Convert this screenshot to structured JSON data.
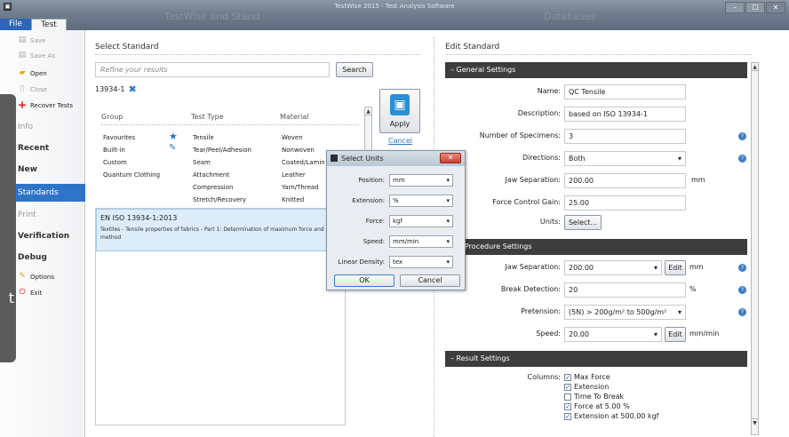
{
  "window": {
    "title": "TestWise 2015 - Test Analysis Software",
    "ghost_left": "TestWise and Stand",
    "ghost_right": "Databases",
    "minimize": "–",
    "maximize": "☐",
    "close": "✕"
  },
  "menu": {
    "file": "File",
    "test": "Test"
  },
  "sidebar": {
    "quick": [
      {
        "label": "Save",
        "icon": "save-icon",
        "enabled": false
      },
      {
        "label": "Save As",
        "icon": "save-as-icon",
        "enabled": false
      },
      {
        "label": "Open",
        "icon": "open-folder-icon",
        "enabled": true
      },
      {
        "label": "Close",
        "icon": "close-doc-icon",
        "enabled": false
      },
      {
        "label": "Recover Tests",
        "icon": "plus-icon",
        "enabled": true
      }
    ],
    "nav": [
      "Info",
      "Recent",
      "New",
      "Standards",
      "Print",
      "Verification",
      "Debug"
    ],
    "options": "Options",
    "exit": "Exit",
    "strip_char": "t"
  },
  "select_standard": {
    "title": "Select Standard",
    "search_placeholder": "Refine your results",
    "search_button": "Search",
    "filter_tag": "13934-1",
    "apply_button": "Apply",
    "cancel_link": "Cancel",
    "columns": [
      "Group",
      "Test Type",
      "Material"
    ],
    "groups": [
      "Favourites",
      "Built-in",
      "Custom",
      "Quantum Clothing"
    ],
    "test_types": [
      "Tensile",
      "Tear/Peel/Adhesion",
      "Seam",
      "Attachment",
      "Compression",
      "Stretch/Recovery"
    ],
    "materials": [
      "Woven",
      "Nonwoven",
      "Coated/Lamin",
      "Leather",
      "Yarn/Thread",
      "Knitted"
    ],
    "result": {
      "code": "EN ISO 13934-1:2013",
      "description": "Textiles - Tensile properties of fabrics - Part 1: Determination of maximum force and elongation at maximum force using the strip method"
    }
  },
  "dialog": {
    "title": "Select Units",
    "close": "✕",
    "fields": [
      {
        "label": "Position:",
        "value": "mm"
      },
      {
        "label": "Extension:",
        "value": "%"
      },
      {
        "label": "Force:",
        "value": "kgf"
      },
      {
        "label": "Speed:",
        "value": "mm/min"
      },
      {
        "label": "Linear Density:",
        "value": "tex"
      }
    ],
    "ok": "OK",
    "cancel": "Cancel"
  },
  "edit_standard": {
    "title": "Edit Standard",
    "general": {
      "header": "– General Settings",
      "name_label": "Name:",
      "name": "QC Tensile",
      "desc_label": "Description:",
      "desc": "based on ISO 13934-1",
      "specimens_label": "Number of Specimens:",
      "specimens": "3",
      "directions_label": "Directions:",
      "directions": "Both",
      "jaw_label": "Jaw Separation:",
      "jaw": "200.00",
      "jaw_unit": "mm",
      "fcg_label": "Force Control Gain:",
      "fcg": "25.00",
      "units_label": "Units:",
      "units_button": "Select..."
    },
    "procedure": {
      "header": "Procedure Settings",
      "jaw_label": "Jaw Separation:",
      "jaw": "200.00",
      "edit": "Edit",
      "jaw_unit": "mm",
      "break_label": "Break Detection:",
      "break": "20",
      "break_unit": "%",
      "pre_label": "Pretension:",
      "pre": "(5N)  > 200g/m² to 500g/m²",
      "speed_label": "Speed:",
      "speed": "20.00",
      "speed_unit": "mm/min"
    },
    "result": {
      "header": "– Result Settings",
      "columns_label": "Columns:",
      "columns": [
        {
          "label": "Max Force",
          "checked": true
        },
        {
          "label": "Extension",
          "checked": true
        },
        {
          "label": "Time To Break",
          "checked": false
        },
        {
          "label": "Force at 5.00 %",
          "checked": true
        },
        {
          "label": "Extension at 500.00 kgf",
          "checked": true
        }
      ]
    }
  }
}
